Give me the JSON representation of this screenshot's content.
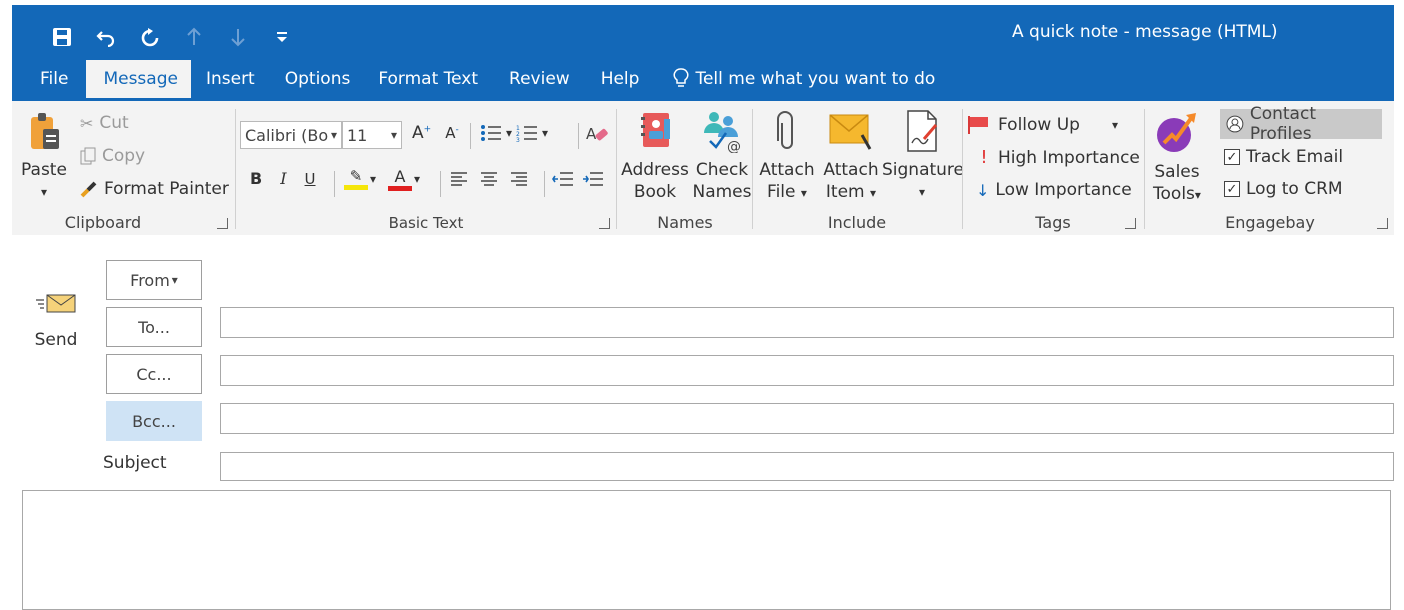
{
  "window": {
    "title": "A quick note - message (HTML)"
  },
  "tabs": [
    "File",
    "Message",
    "Insert",
    "Options",
    "Format Text",
    "Review",
    "Help"
  ],
  "tell_me": "Tell me what you want to do",
  "ribbon": {
    "clipboard": {
      "paste": "Paste",
      "cut": "Cut",
      "copy": "Copy",
      "format_painter": "Format Painter",
      "label": "Clipboard"
    },
    "basic_text": {
      "font_name": "Calibri (Bo",
      "font_size": "11",
      "bold": "B",
      "italic": "I",
      "underline": "U",
      "font_color_letter": "A",
      "highlight_color": "#f5e60a",
      "font_color": "#e01f1f",
      "label": "Basic Text"
    },
    "names": {
      "address_book_1": "Address",
      "address_book_2": "Book",
      "check_names_1": "Check",
      "check_names_2": "Names",
      "label": "Names"
    },
    "include": {
      "attach_file_1": "Attach",
      "attach_file_2": "File",
      "attach_item_1": "Attach",
      "attach_item_2": "Item",
      "signature": "Signature",
      "label": "Include"
    },
    "tags": {
      "follow_up": "Follow Up",
      "high_importance": "High Importance",
      "low_importance": "Low Importance",
      "label": "Tags"
    },
    "engagebay": {
      "sales_tools_1": "Sales",
      "sales_tools_2": "Tools",
      "contact_profiles": "Contact Profiles",
      "track_email": "Track Email",
      "log_to_crm": "Log to CRM",
      "label": "Engagebay"
    }
  },
  "compose": {
    "send": "Send",
    "from": "From",
    "to": "To...",
    "cc": "Cc...",
    "bcc": "Bcc...",
    "subject": "Subject",
    "to_value": "",
    "cc_value": "",
    "bcc_value": "",
    "subject_value": ""
  },
  "colors": {
    "accent": "#1368b8",
    "ribbon_bg": "#f3f3f3"
  }
}
